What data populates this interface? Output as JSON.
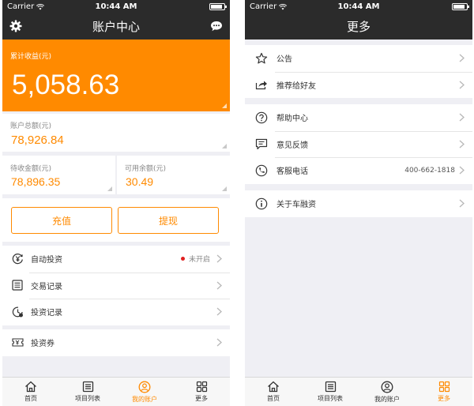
{
  "status": {
    "carrier": "Carrier",
    "time": "10:44 AM"
  },
  "left": {
    "nav_title": "账户中心",
    "hero": {
      "label": "累计收益(元)",
      "value": "5,058.63"
    },
    "total": {
      "label": "账户总额(元)",
      "value": "78,926.84"
    },
    "pending": {
      "label": "待收金额(元)",
      "value": "78,896.35"
    },
    "available": {
      "label": "可用余额(元)",
      "value": "30.49"
    },
    "buttons": {
      "recharge": "充值",
      "withdraw": "提现"
    },
    "menu": [
      {
        "label": "自动投资",
        "status": "未开启",
        "icon": "auto-invest-icon"
      },
      {
        "label": "交易记录",
        "icon": "list-icon"
      },
      {
        "label": "投资记录",
        "icon": "clock-icon"
      },
      {
        "label": "投资券",
        "icon": "coupon-icon"
      }
    ]
  },
  "right": {
    "nav_title": "更多",
    "items": [
      {
        "label": "公告",
        "icon": "star-icon"
      },
      {
        "label": "推荐给好友",
        "icon": "share-icon"
      },
      {
        "label": "帮助中心",
        "icon": "question-icon"
      },
      {
        "label": "意见反馈",
        "icon": "feedback-icon"
      },
      {
        "label": "客服电话",
        "value": "400-662-1818",
        "icon": "phone-icon"
      },
      {
        "label": "关于车融资",
        "icon": "info-icon"
      }
    ]
  },
  "tabs": [
    {
      "label": "首页",
      "icon": "home-icon"
    },
    {
      "label": "项目列表",
      "icon": "list-icon"
    },
    {
      "label": "我的账户",
      "icon": "user-icon"
    },
    {
      "label": "更多",
      "icon": "grid-icon"
    }
  ],
  "colors": {
    "accent": "#ff8a00",
    "navbar": "#2b2b2b",
    "background": "#efeff4",
    "alert": "#e02020"
  }
}
